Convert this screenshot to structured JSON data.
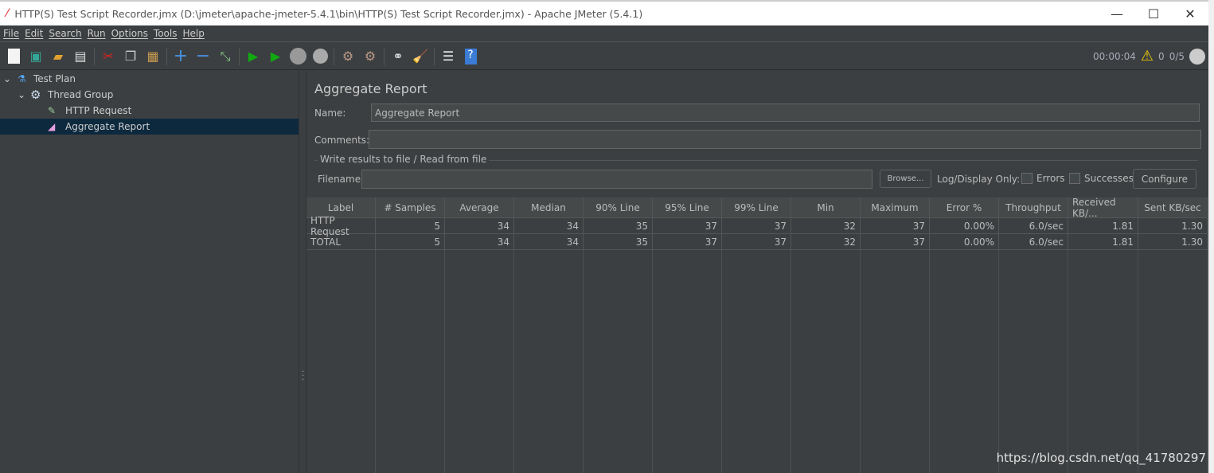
{
  "window": {
    "title": "HTTP(S) Test Script Recorder.jmx (D:\\jmeter\\apache-jmeter-5.4.1\\bin\\HTTP(S) Test Script Recorder.jmx) - Apache JMeter (5.4.1)",
    "minimize": "—",
    "maximize": "☐",
    "close": "✕"
  },
  "menu": [
    "File",
    "Edit",
    "Search",
    "Run",
    "Options",
    "Tools",
    "Help"
  ],
  "toolbar": [
    "new-icon",
    "templates-icon",
    "open-icon",
    "save-icon",
    "cut-icon",
    "copy-icon",
    "paste-icon",
    "expand-icon",
    "collapse-icon",
    "toggle-icon",
    "start-icon",
    "start-no-pause-icon",
    "stop-icon",
    "shutdown-icon",
    "clear-icon",
    "clear-all-icon",
    "search-icon",
    "reset-search-icon",
    "function-helper-icon",
    "help-icon"
  ],
  "status": {
    "elapsed": "00:00:04",
    "warnings": "0",
    "threads": "0/5"
  },
  "tree": [
    {
      "label": "Test Plan"
    },
    {
      "label": "Thread Group"
    },
    {
      "label": "HTTP Request"
    },
    {
      "label": "Aggregate Report",
      "selected": true
    }
  ],
  "panel": {
    "title": "Aggregate Report",
    "name_label": "Name:",
    "name_value": "Aggregate Report",
    "comments_label": "Comments:",
    "comments_value": "",
    "file_group": "Write results to file / Read from file",
    "filename_label": "Filename",
    "filename_value": "",
    "browse": "Browse...",
    "log_display": "Log/Display Only:",
    "errors": "Errors",
    "successes": "Successes",
    "configure": "Configure"
  },
  "table": {
    "columns": [
      "Label",
      "# Samples",
      "Average",
      "Median",
      "90% Line",
      "95% Line",
      "99% Line",
      "Min",
      "Maximum",
      "Error %",
      "Throughput",
      "Received KB/...",
      "Sent KB/sec"
    ],
    "rows": [
      [
        "HTTP Request",
        "5",
        "34",
        "34",
        "35",
        "37",
        "37",
        "32",
        "37",
        "0.00%",
        "6.0/sec",
        "1.81",
        "1.30"
      ],
      [
        "TOTAL",
        "5",
        "34",
        "34",
        "35",
        "37",
        "37",
        "32",
        "37",
        "0.00%",
        "6.0/sec",
        "1.81",
        "1.30"
      ]
    ]
  },
  "watermark": "https://blog.csdn.net/qq_41780297",
  "colors": {
    "bg": "#3c3f41",
    "selection": "#0d293e",
    "input": "#45494a"
  }
}
